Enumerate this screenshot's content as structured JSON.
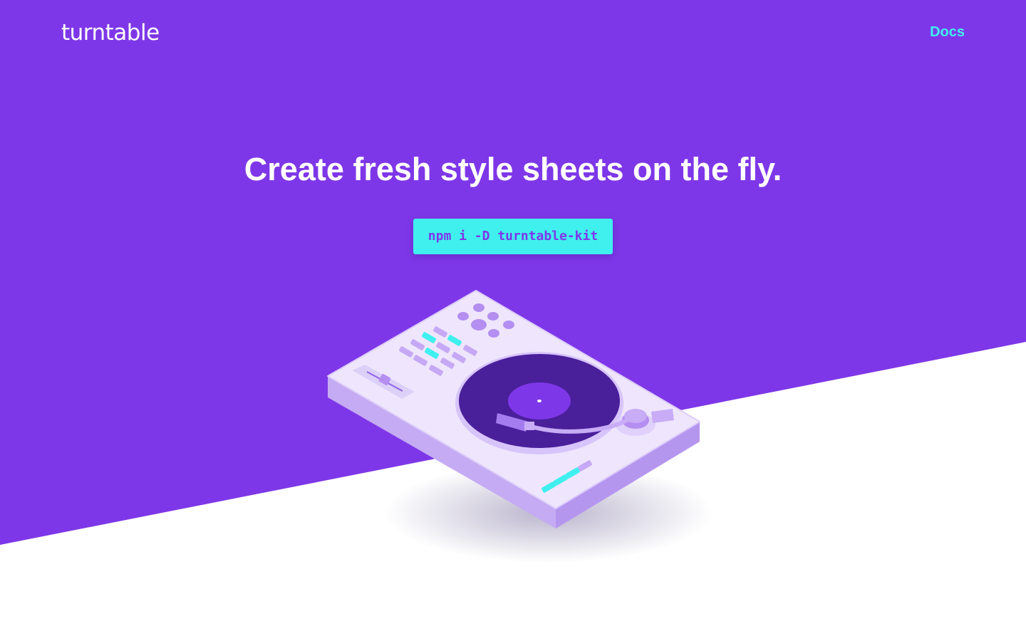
{
  "colors": {
    "brand_purple": "#7e37e8",
    "accent_cyan": "#40f0ef",
    "background_white": "#ffffff"
  },
  "header": {
    "logo_text": "turntable",
    "nav": {
      "docs_label": "Docs"
    }
  },
  "hero": {
    "title": "Create fresh style sheets on the fly.",
    "install_command": "npm i -D turntable-kit"
  },
  "illustration": {
    "icon": "turntable-illustration"
  }
}
